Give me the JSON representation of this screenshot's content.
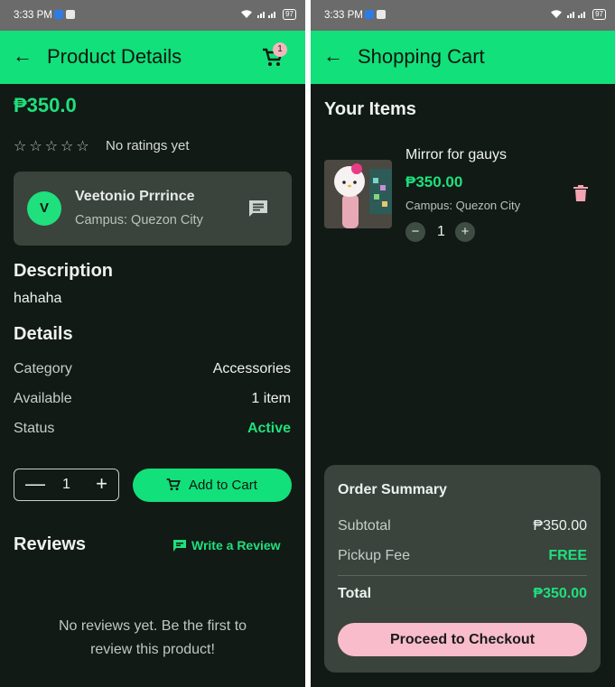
{
  "status_bar": {
    "time": "3:33 PM",
    "battery": "97"
  },
  "colors": {
    "accent": "#12e07a",
    "background": "#121a15",
    "card": "#3a433c",
    "pink": "#f8bccb"
  },
  "product_screen": {
    "title": "Product Details",
    "cart_badge": "1",
    "price": "₱350.0",
    "stars": [
      "☆",
      "☆",
      "☆",
      "☆",
      "☆"
    ],
    "rating_text": "No ratings yet",
    "seller": {
      "initial": "V",
      "name": "Veetonio Prrrince",
      "campus": "Campus: Quezon City"
    },
    "description_title": "Description",
    "description": "hahaha",
    "details_title": "Details",
    "details": [
      {
        "label": "Category",
        "value": "Accessories"
      },
      {
        "label": "Available",
        "value": "1 item"
      },
      {
        "label": "Status",
        "value": "Active"
      }
    ],
    "quantity": "1",
    "add_to_cart": "Add to Cart",
    "reviews_title": "Reviews",
    "write_review": "Write a Review",
    "empty_reviews": "No reviews yet. Be the first to review this product!"
  },
  "cart_screen": {
    "title": "Shopping Cart",
    "section_title": "Your Items",
    "item": {
      "name": "Mirror for gauys",
      "price": "₱350.00",
      "campus": "Campus: Quezon City",
      "quantity": "1"
    },
    "summary": {
      "title": "Order Summary",
      "subtotal_label": "Subtotal",
      "subtotal_value": "₱350.00",
      "fee_label": "Pickup Fee",
      "fee_value": "FREE",
      "total_label": "Total",
      "total_value": "₱350.00",
      "checkout": "Proceed to Checkout"
    }
  }
}
